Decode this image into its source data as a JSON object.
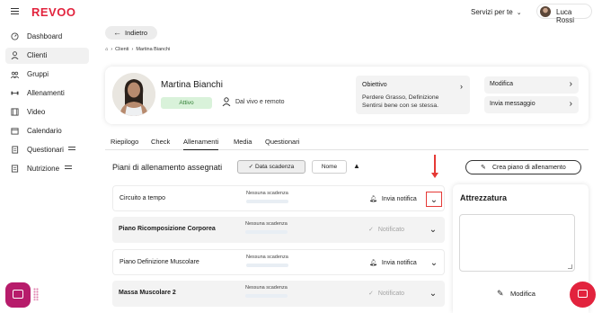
{
  "app": {
    "logo": "REVOO",
    "services_label": "Servizi per te",
    "user_name": "Luca Rossi"
  },
  "sidebar": {
    "items": [
      {
        "label": "Dashboard",
        "icon": "gauge-icon"
      },
      {
        "label": "Clienti",
        "icon": "user-icon",
        "active": true
      },
      {
        "label": "Gruppi",
        "icon": "group-icon"
      },
      {
        "label": "Allenamenti",
        "icon": "dumbbell-icon"
      },
      {
        "label": "Video",
        "icon": "film-icon"
      },
      {
        "label": "Calendario",
        "icon": "calendar-icon"
      },
      {
        "label": "Questionari",
        "icon": "document-icon",
        "has_menu_icon": true
      },
      {
        "label": "Nutrizione",
        "icon": "document-icon",
        "has_menu_icon": true
      }
    ]
  },
  "header": {
    "back_label": "Indietro",
    "breadcrumb": [
      "Clienti",
      "Martina Bianchi"
    ]
  },
  "client": {
    "name": "Martina Bianchi",
    "status": "Attivo",
    "mode": "Dal vivo e remoto",
    "goal_title": "Obiettivo",
    "goal_text": "Perdere Grasso, Definizione Sentirsi bene con se stessa.",
    "edit_label": "Modifica",
    "message_label": "Invia messaggio"
  },
  "tabs": [
    {
      "label": "Riepilogo"
    },
    {
      "label": "Check"
    },
    {
      "label": "Allenamenti",
      "active": true
    },
    {
      "label": "Media"
    },
    {
      "label": "Questionari"
    }
  ],
  "plans": {
    "title": "Piani di allenamento assegnati",
    "sort_date_label": "Data scadenza",
    "sort_name_label": "Nome",
    "sort_direction": "▲",
    "create_label": "Crea piano di allenamento",
    "rows": [
      {
        "name": "Circuito a tempo",
        "deadline": "Nessuna scadenza",
        "action": "Invia notifica",
        "notified": false
      },
      {
        "name": "Piano Ricomposizione Corporea",
        "deadline": "Nessuna scadenza",
        "action": "Notificato",
        "notified": true
      },
      {
        "name": "Piano Definizione Muscolare",
        "deadline": "Nessuna scadenza",
        "action": "Invia notifica",
        "notified": false
      },
      {
        "name": "Massa Muscolare 2",
        "deadline": "Nessuna scadenza",
        "action": "Notificato",
        "notified": true
      }
    ]
  },
  "equipment": {
    "title": "Attrezzatura",
    "edit_label": "Modifica"
  },
  "colors": {
    "brand": "#e2233d",
    "status_active_bg": "#d9f2da",
    "status_active_fg": "#2e7d32",
    "annotation": "#e53935",
    "chat_fab": "#b71c6b"
  }
}
